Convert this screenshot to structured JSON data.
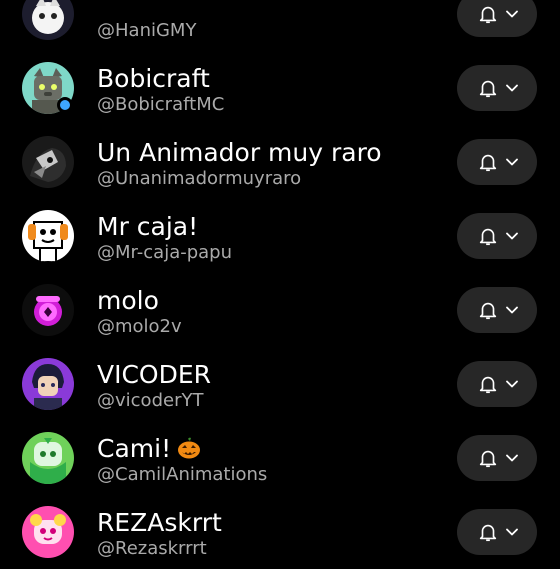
{
  "subscriptions": [
    {
      "name": "",
      "handle": "@HaniGMY",
      "avatar": "avatar-hanigmy"
    },
    {
      "name": "Bobicraft",
      "handle": "@BobicraftMC",
      "avatar": "avatar-bobicraft",
      "verified": true
    },
    {
      "name": "Un Animador muy raro",
      "handle": "@Unanimadormuyraro",
      "avatar": "avatar-unanimador"
    },
    {
      "name": "Mr caja!",
      "handle": "@Mr-caja-papu",
      "avatar": "avatar-mrcaja"
    },
    {
      "name": "molo",
      "handle": "@molo2v",
      "avatar": "avatar-molo"
    },
    {
      "name": "VICODER",
      "handle": "@vicoderYT",
      "avatar": "avatar-vicoder"
    },
    {
      "name": "Cami!",
      "handle": "@CamilAnimations",
      "avatar": "avatar-cami",
      "emoji": "jack-o-lantern-emoji"
    },
    {
      "name": "REZAskrrt",
      "handle": "@Rezaskrrrt",
      "avatar": "avatar-rezaskrrt"
    }
  ],
  "colors": {
    "background": "#000000",
    "button_bg": "#272727",
    "name_text": "#ffffff",
    "handle_text": "#aaaaaa",
    "verified_badge": "#3ea6ff"
  },
  "icons": {
    "bell": "bell-icon",
    "chevron": "chevron-down-icon"
  }
}
